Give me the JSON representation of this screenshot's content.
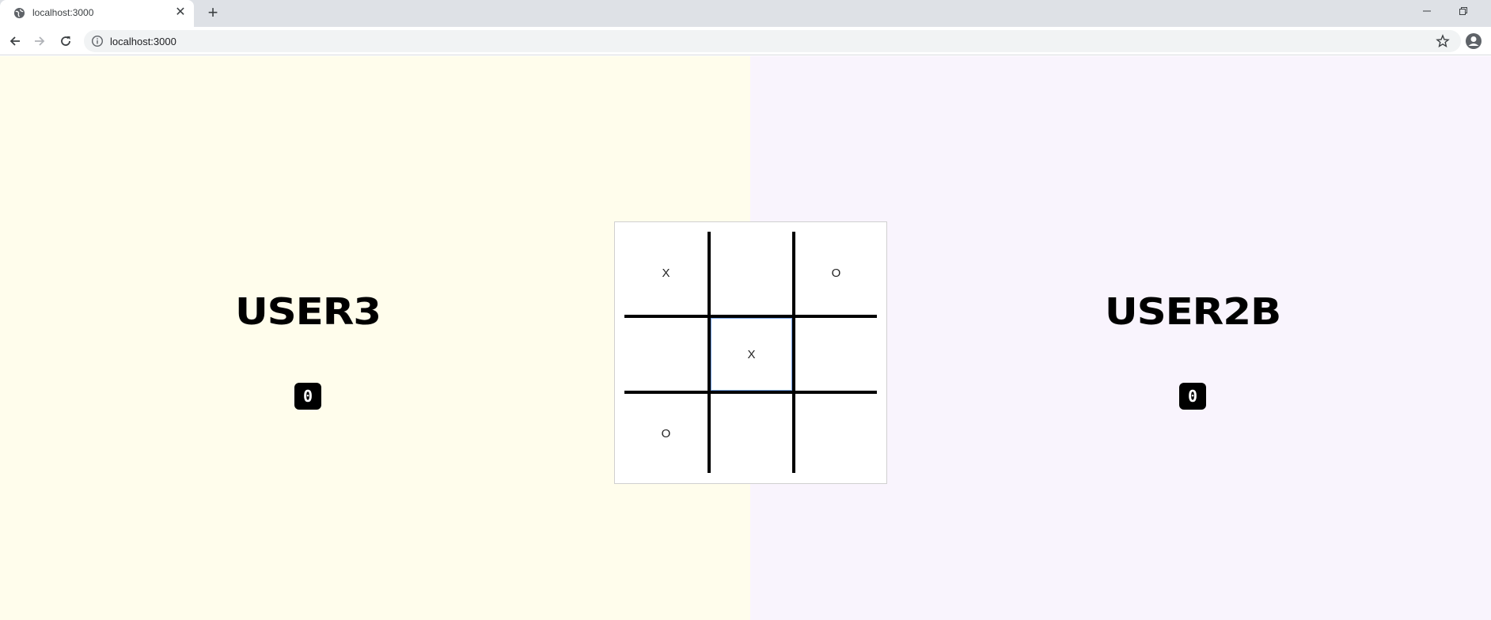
{
  "browser": {
    "tab_title": "localhost:3000",
    "url": "localhost:3000",
    "icons": {
      "favicon": "globe-icon",
      "close": "close-icon",
      "new_tab": "plus-icon",
      "back": "arrow-left-icon",
      "forward": "arrow-right-icon",
      "reload": "reload-icon",
      "info": "info-icon",
      "bookmark": "star-icon",
      "profile": "account-icon",
      "minimize": "minimize-icon",
      "restore": "restore-icon"
    },
    "close_glyph": "✕",
    "new_tab_glyph": "+"
  },
  "players": {
    "left": {
      "name": "USER3",
      "score": "0",
      "background": "#fffdec"
    },
    "right": {
      "name": "USER2B",
      "score": "0",
      "background": "#f9f4fd"
    }
  },
  "board": {
    "cells": [
      "X",
      "",
      "O",
      "",
      "X",
      "",
      "O",
      "",
      ""
    ],
    "focused_cell": 4
  }
}
